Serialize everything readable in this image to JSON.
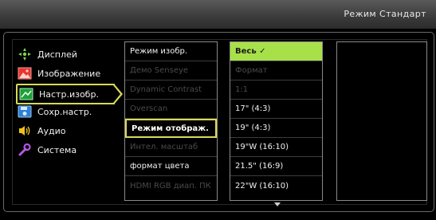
{
  "header": {
    "mode_title": "Режим Стандарт"
  },
  "menu": {
    "items": [
      {
        "label": "Дисплей",
        "icon": "display-icon"
      },
      {
        "label": "Изображение",
        "icon": "picture-icon"
      },
      {
        "label": "Настр.изобр.",
        "icon": "picture-adjust-icon"
      },
      {
        "label": "Сохр.настр.",
        "icon": "save-settings-icon"
      },
      {
        "label": "Аудио",
        "icon": "speaker-icon"
      },
      {
        "label": "Система",
        "icon": "wrench-icon"
      }
    ]
  },
  "submenu": {
    "items": [
      {
        "label": "Режим изобр."
      },
      {
        "label": "Демо Senseye"
      },
      {
        "label": "Dynamic Contrast"
      },
      {
        "label": "Overscan"
      },
      {
        "label": "Режим отображ."
      },
      {
        "label": "Интел. масштаб"
      },
      {
        "label": "формат цвета"
      },
      {
        "label": "HDMI RGB диап. ПК"
      }
    ]
  },
  "options": {
    "items": [
      {
        "label": "Весь ✓"
      },
      {
        "label": "Формат"
      },
      {
        "label": "1:1"
      },
      {
        "label": "17\" (4:3)"
      },
      {
        "label": "19\" (4:3)"
      },
      {
        "label": "19\"W (16:10)"
      },
      {
        "label": "21.5\" (16:9)"
      },
      {
        "label": "22\"W (16:10)"
      }
    ]
  },
  "colors": {
    "accent_yellow": "#d9d95a",
    "highlight_green": "#a8e04a"
  }
}
